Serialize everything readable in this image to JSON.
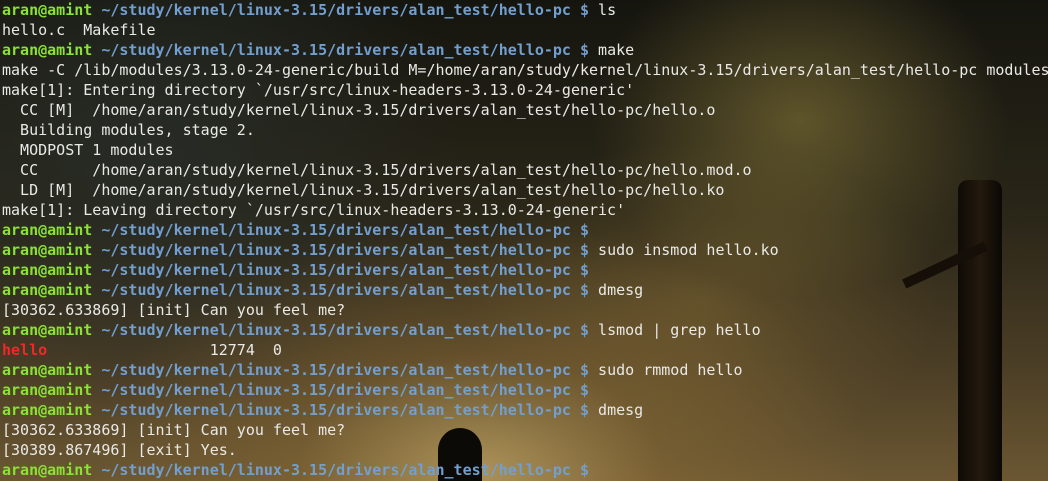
{
  "prompt": {
    "user": "aran@amint",
    "cwd": " ~/study/kernel/linux-3.15/drivers/alan_test/hello-pc",
    "symbol": " $"
  },
  "colors": {
    "user": "#8ae234",
    "cwd": "#729fcf",
    "text": "#e9e9e6",
    "highlight": "#ef2929"
  },
  "lines": [
    {
      "type": "prompt",
      "cmd": " ls"
    },
    {
      "type": "output",
      "text": "hello.c  Makefile"
    },
    {
      "type": "prompt",
      "cmd": " make"
    },
    {
      "type": "output",
      "text": "make -C /lib/modules/3.13.0-24-generic/build M=/home/aran/study/kernel/linux-3.15/drivers/alan_test/hello-pc modules"
    },
    {
      "type": "output",
      "text": "make[1]: Entering directory `/usr/src/linux-headers-3.13.0-24-generic'"
    },
    {
      "type": "output",
      "text": "  CC [M]  /home/aran/study/kernel/linux-3.15/drivers/alan_test/hello-pc/hello.o"
    },
    {
      "type": "output",
      "text": "  Building modules, stage 2."
    },
    {
      "type": "output",
      "text": "  MODPOST 1 modules"
    },
    {
      "type": "output",
      "text": "  CC      /home/aran/study/kernel/linux-3.15/drivers/alan_test/hello-pc/hello.mod.o"
    },
    {
      "type": "output",
      "text": "  LD [M]  /home/aran/study/kernel/linux-3.15/drivers/alan_test/hello-pc/hello.ko"
    },
    {
      "type": "output",
      "text": "make[1]: Leaving directory `/usr/src/linux-headers-3.13.0-24-generic'"
    },
    {
      "type": "prompt",
      "cmd": ""
    },
    {
      "type": "prompt",
      "cmd": " sudo insmod hello.ko"
    },
    {
      "type": "prompt",
      "cmd": ""
    },
    {
      "type": "prompt",
      "cmd": " dmesg"
    },
    {
      "type": "output",
      "text": "[30362.633869] [init] Can you feel me?"
    },
    {
      "type": "prompt",
      "cmd": " lsmod | grep hello"
    },
    {
      "type": "lsmod",
      "name": "hello",
      "rest": "                  12774  0"
    },
    {
      "type": "prompt",
      "cmd": " sudo rmmod hello"
    },
    {
      "type": "prompt",
      "cmd": ""
    },
    {
      "type": "prompt",
      "cmd": " dmesg"
    },
    {
      "type": "output",
      "text": "[30362.633869] [init] Can you feel me?"
    },
    {
      "type": "output",
      "text": "[30389.867496] [exit] Yes."
    },
    {
      "type": "prompt",
      "cmd": ""
    }
  ]
}
